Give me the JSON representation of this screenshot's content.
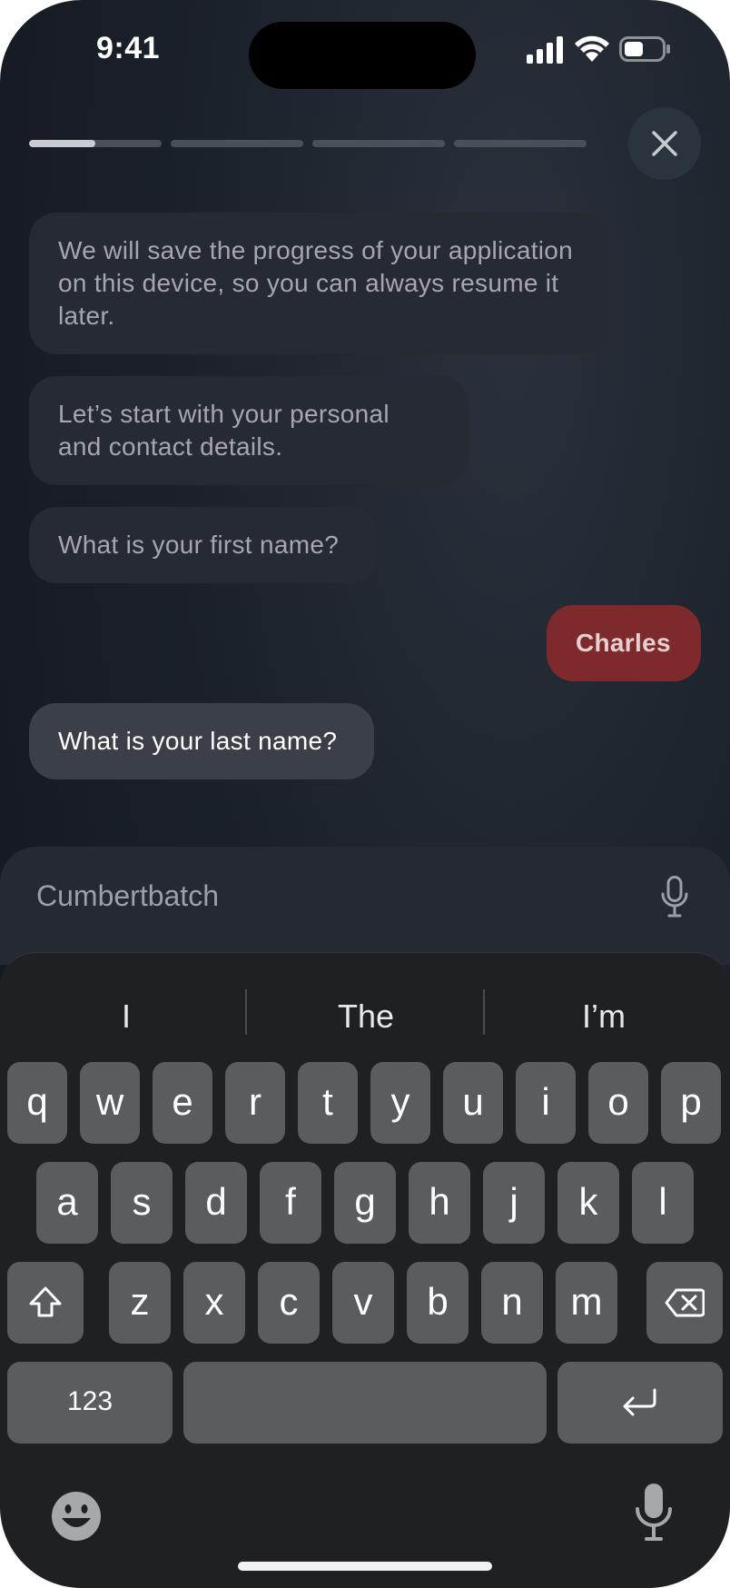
{
  "status": {
    "time": "9:41",
    "icons": [
      "cellular-signal-icon",
      "wifi-icon",
      "battery-icon"
    ]
  },
  "progress": {
    "segments": 4,
    "current_segment": 1,
    "segment_fill": [
      0.5,
      0,
      0,
      0
    ]
  },
  "header": {
    "close_icon": "close-icon"
  },
  "chat": {
    "messages": [
      {
        "from": "bot",
        "text": "We will save the progress of your application on this device, so you can always resume it later."
      },
      {
        "from": "bot",
        "text": "Let’s start with your personal and contact details."
      },
      {
        "from": "bot",
        "text": "What is your first name?"
      },
      {
        "from": "user",
        "text": "Charles"
      },
      {
        "from": "bot",
        "text": "What is your last name?"
      }
    ]
  },
  "input": {
    "value": "Cumbertbatch",
    "mic_icon": "microphone-icon"
  },
  "keyboard": {
    "suggestions": [
      "I",
      "The",
      "I’m"
    ],
    "row1": [
      "q",
      "w",
      "e",
      "r",
      "t",
      "y",
      "u",
      "i",
      "o",
      "p"
    ],
    "row2": [
      "a",
      "s",
      "d",
      "f",
      "g",
      "h",
      "j",
      "k",
      "l"
    ],
    "row3": [
      "z",
      "x",
      "c",
      "v",
      "b",
      "n",
      "m"
    ],
    "numbers_label": "123",
    "icons": [
      "shift-icon",
      "delete-icon",
      "return-icon",
      "emoji-icon",
      "dictation-icon"
    ]
  },
  "colors": {
    "background": "#1b212a",
    "user_bubble": "#7e2a2d",
    "bot_bubble": "#262b33",
    "key": "#5a5c5e",
    "keyboard": "#1f2023"
  }
}
